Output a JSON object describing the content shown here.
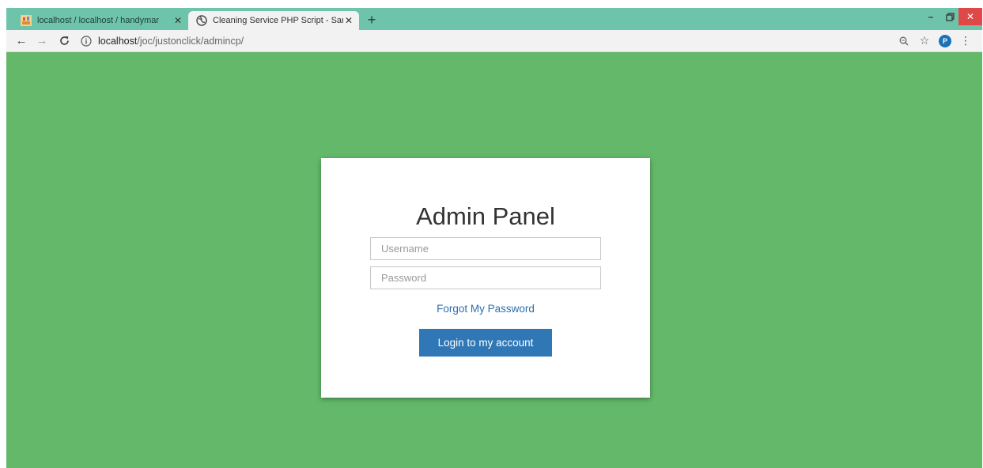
{
  "browser": {
    "tabs": [
      {
        "title": "localhost / localhost / handymar",
        "active": false,
        "favicon": "phpmyadmin-icon"
      },
      {
        "title": "Cleaning Service PHP Script - Sar",
        "active": true,
        "favicon": "globe-icon"
      }
    ],
    "close_glyph": "✕",
    "new_tab_glyph": "+",
    "window_controls": {
      "minimize": "–",
      "maximize": "🗗",
      "close": "✕"
    },
    "nav": {
      "back": "←",
      "forward": "→",
      "reload": "C"
    },
    "url": {
      "host": "localhost",
      "path": "/joc/justonclick/admincp/"
    },
    "right_icons": {
      "zoom": "🔍",
      "bookmark": "☆",
      "profile_initial": "P",
      "menu": "⋮"
    }
  },
  "login": {
    "title": "Admin Panel",
    "username_placeholder": "Username",
    "password_placeholder": "Password",
    "forgot_link": "Forgot My Password",
    "submit_label": "Login to my account"
  },
  "colors": {
    "page_background": "#63b969",
    "tab_strip": "#6ec4aa",
    "button": "#3077b6",
    "link": "#2c6fae"
  }
}
